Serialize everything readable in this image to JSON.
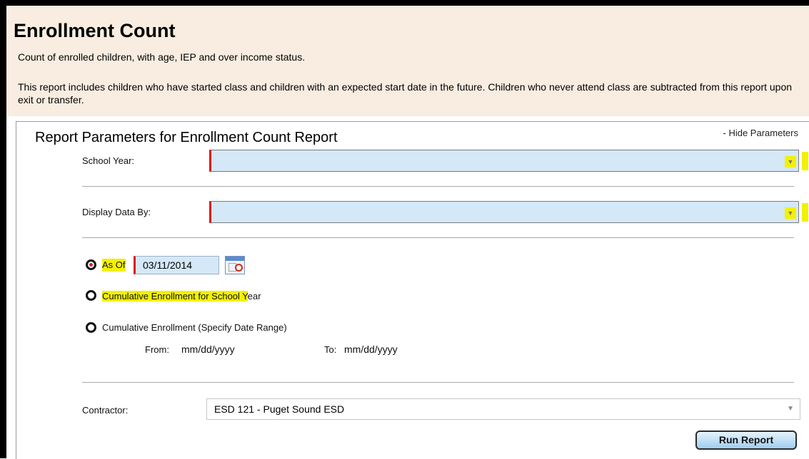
{
  "header": {
    "title": "Enrollment Count",
    "subtitle": "Count of enrolled children, with age, IEP and over income status.",
    "description": "This report includes children who have started class and children with an expected start date in the future. Children who never attend class are subtracted from this report upon exit or transfer."
  },
  "panel": {
    "title": "Report Parameters for Enrollment Count Report",
    "hide_link": "- Hide Parameters"
  },
  "params": {
    "school_year_label": "School Year:",
    "display_data_by_label": "Display Data By:",
    "options": [
      {
        "label": "As Of",
        "selected": true
      },
      {
        "label_a": "Cumulative Enrollment for School ",
        "label_b": "Y",
        "label_c": "ear",
        "selected": false
      },
      {
        "label": "Cumulative Enrollment (Specify Date Range)",
        "selected": false
      }
    ],
    "as_of_value": "03/11/2014",
    "from_label": "From:",
    "from_value": "mm/dd/yyyy",
    "to_label": "To:",
    "to_value": "mm/dd/yyyy",
    "contractor_label": "Contractor:",
    "contractor_value": "ESD 121 - Puget Sound ESD",
    "run_button": "Run Report"
  },
  "colors": {
    "header_bg": "#f8ede0",
    "select_bg": "#d4e8f8",
    "required_marker": "#e01010",
    "highlight": "#f3f100"
  }
}
